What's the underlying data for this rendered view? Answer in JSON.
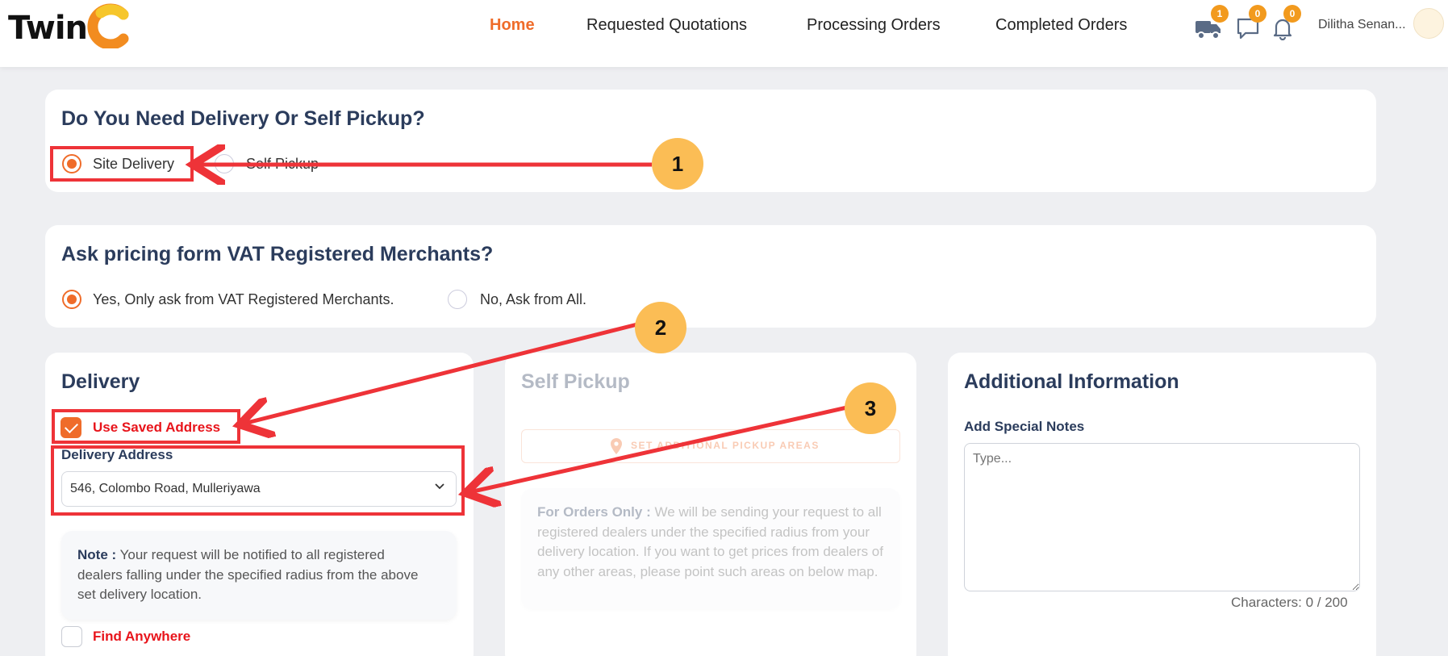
{
  "header": {
    "logo_text": "Twin",
    "nav": [
      {
        "label": "Home",
        "active": true
      },
      {
        "label": "Requested Quotations",
        "active": false
      },
      {
        "label": "Processing Orders",
        "active": false
      },
      {
        "label": "Completed Orders",
        "active": false
      }
    ],
    "badges": {
      "delivery": "1",
      "messages": "0",
      "notifications": "0"
    },
    "user_name": "Dilitha Senan..."
  },
  "delivery_mode": {
    "title": "Do You Need Delivery Or Self Pickup?",
    "options": [
      {
        "label": "Site Delivery",
        "selected": true
      },
      {
        "label": "Self Pickup",
        "selected": false
      }
    ]
  },
  "vat": {
    "title": "Ask pricing form VAT Registered Merchants?",
    "options": [
      {
        "label": "Yes, Only ask from VAT Registered Merchants.",
        "selected": true
      },
      {
        "label": "No, Ask from All.",
        "selected": false
      }
    ]
  },
  "delivery": {
    "title": "Delivery",
    "use_saved_address_label": "Use Saved Address",
    "use_saved_address_checked": true,
    "address_label": "Delivery Address",
    "address_value": "546, Colombo Road, Mulleriyawa",
    "note_bold": "Note :",
    "note_text": " Your request will be notified to all registered dealers falling under the specified radius from the above set delivery location.",
    "find_anywhere_label": "Find Anywhere",
    "find_anywhere_checked": false
  },
  "self_pickup": {
    "title": "Self Pickup",
    "button_label": "SET ADDITIONAL PICKUP AREAS",
    "note_bold": "For Orders Only :",
    "note_text": " We will be sending your request to all registered dealers under the specified radius from your delivery location. If you want to get prices from dealers of any other areas, please point such areas on below map."
  },
  "additional": {
    "title": "Additional Information",
    "notes_label": "Add Special Notes",
    "notes_placeholder": "Type...",
    "char_count": "Characters: 0 / 200"
  },
  "annotations": {
    "markers": [
      "1",
      "2",
      "3"
    ],
    "color": "#ee3338",
    "marker_color": "#fbbd55"
  },
  "colors": {
    "accent": "#ef6c2a",
    "heading": "#2b3c5c",
    "warning_red": "#e8141b"
  }
}
